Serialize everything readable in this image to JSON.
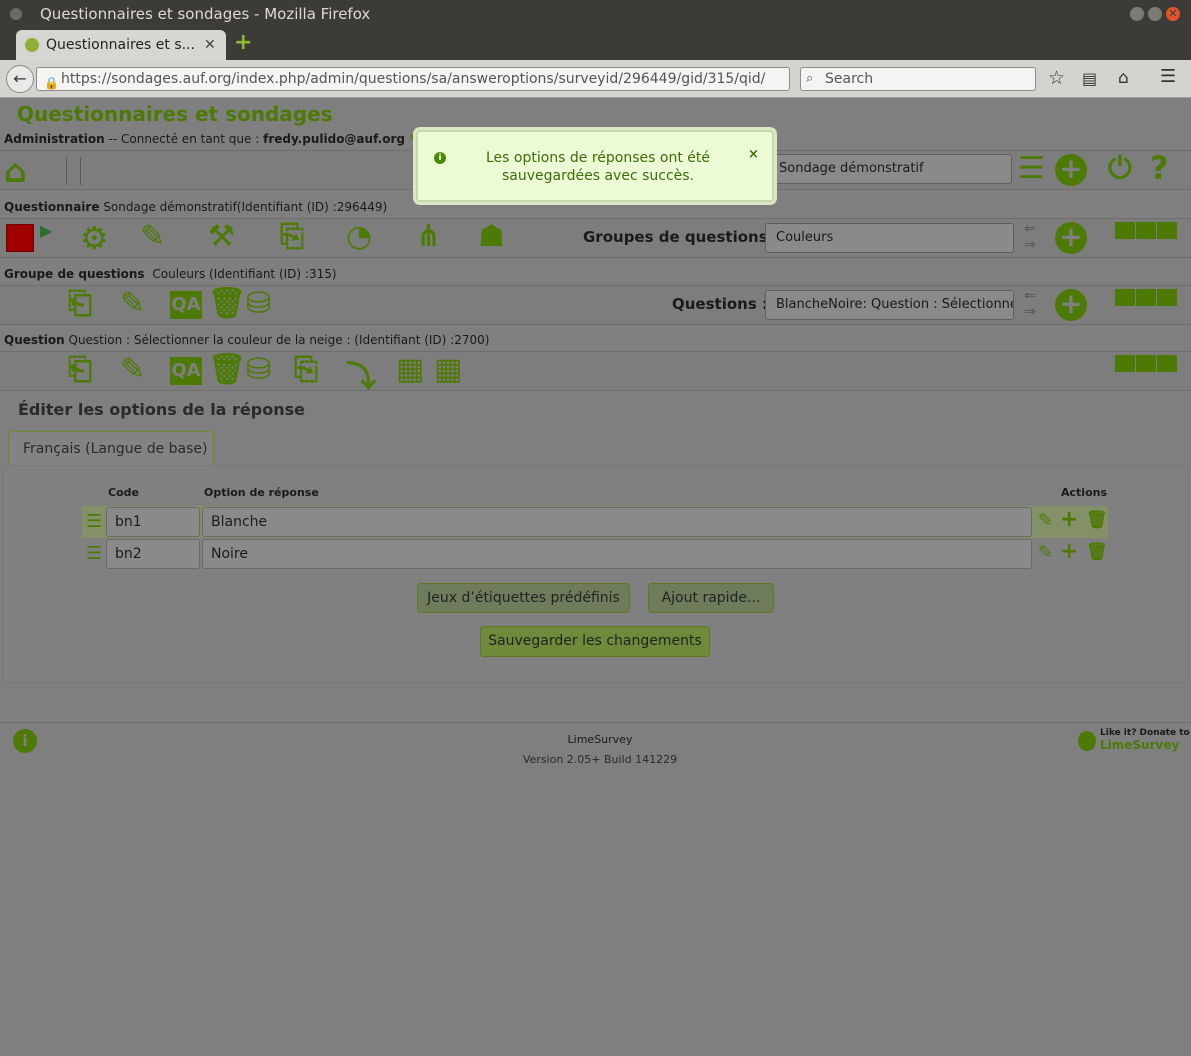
{
  "window": {
    "title": "Questionnaires et sondages - Mozilla Firefox"
  },
  "browser": {
    "tab_title": "Questionnaires et s...",
    "url": "https://sondages.auf.org/index.php/admin/questions/sa/answeroptions/surveyid/296449/gid/315/qid/",
    "search_placeholder": "Search"
  },
  "app": {
    "title": "Questionnaires et sondages"
  },
  "admin_bar": {
    "label": "Administration",
    "connected_text": "-- Connecté en tant que :",
    "user": "fredy.pulido@auf.org",
    "survey_select": "Sondage démonstratif"
  },
  "survey_bar": {
    "label": "Questionnaire",
    "text": "Sondage démonstratif(Identifiant (ID) :296449)",
    "groups_label": "Groupes de questions :",
    "groups_select": "Couleurs"
  },
  "group_bar": {
    "label": "Groupe de questions",
    "text": "Couleurs (Identifiant (ID) :315)",
    "questions_label": "Questions :",
    "questions_select": "BlancheNoire: Question : Sélectionne"
  },
  "question_bar": {
    "label": "Question",
    "text": "Question : Sélectionner la couleur de la neige : (Identifiant (ID) :2700)"
  },
  "editor": {
    "heading": "Éditer les options de la réponse",
    "language_tab": "Français (Langue de base)",
    "col_code": "Code",
    "col_option": "Option de réponse",
    "col_actions": "Actions",
    "rows": [
      {
        "code": "bn1",
        "answer": "Blanche"
      },
      {
        "code": "bn2",
        "answer": "Noire"
      }
    ],
    "predefined_button": "Jeux d’étiquettes prédéfinis",
    "quick_add_button": "Ajout rapide...",
    "save_button": "Sauvegarder les changements"
  },
  "notification": {
    "line1": "Les options de réponses ont été",
    "line2": "sauvegardées avec succès.",
    "close": "×"
  },
  "footer": {
    "product": "LimeSurvey",
    "version": "Version 2.05+ Build 141229",
    "donate_line1": "Like it? Donate to",
    "donate_line2": "LimeSurvey"
  }
}
